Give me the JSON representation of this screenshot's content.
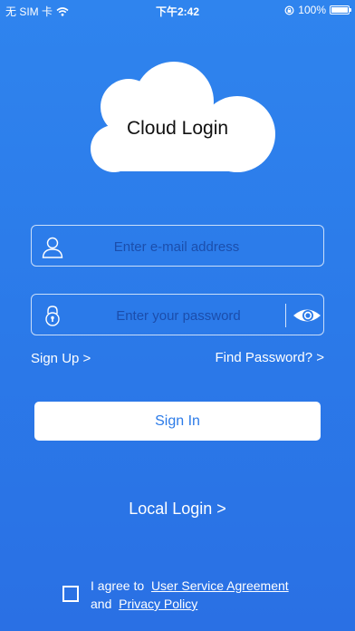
{
  "status_bar": {
    "carrier": "无 SIM 卡",
    "time": "下午2:42",
    "battery": "100%"
  },
  "title": "Cloud Login",
  "email": {
    "placeholder": "Enter e-mail address",
    "value": ""
  },
  "password": {
    "placeholder": "Enter your password",
    "value": ""
  },
  "links": {
    "sign_up": "Sign Up >",
    "find_password": "Find Password? >"
  },
  "sign_in_label": "Sign In",
  "local_login_label": "Local Login >",
  "agreement": {
    "prefix": "I agree to",
    "user_agreement": "User Service Agreement",
    "and": "and",
    "privacy_policy": "Privacy Policy"
  },
  "colors": {
    "background_top": "#2f84ee",
    "background_bottom": "#2a70e4",
    "button_text": "#2c7be8"
  },
  "icons": [
    "wifi-icon",
    "lock-rotation-icon",
    "battery-icon",
    "cloud-icon",
    "user-icon",
    "lock-icon",
    "eye-icon"
  ]
}
